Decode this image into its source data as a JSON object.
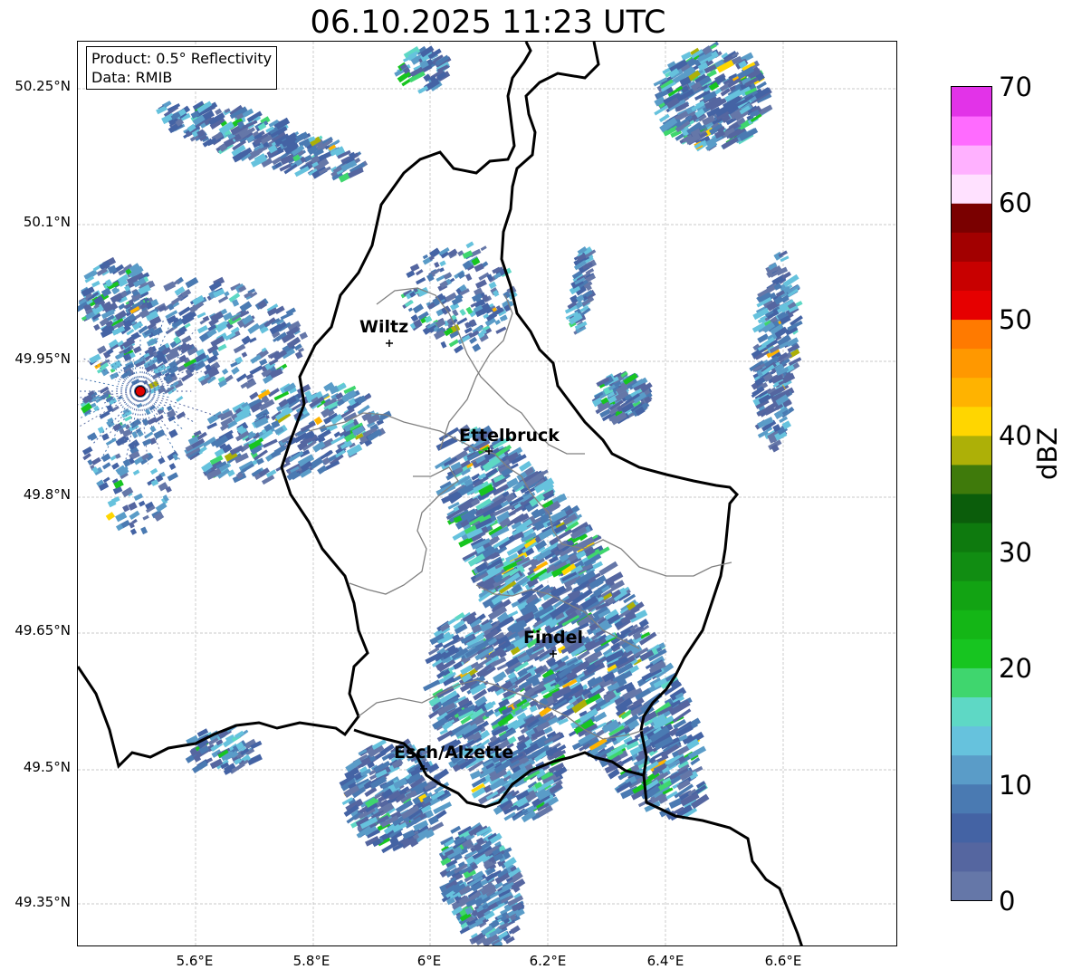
{
  "title": "06.10.2025 11:23 UTC",
  "info": {
    "product": "Product: 0.5° Reflectivity",
    "source": "Data: RMIB"
  },
  "axes": {
    "lat_labels": [
      "50.25°N",
      "50.1°N",
      "49.95°N",
      "49.8°N",
      "49.65°N",
      "49.5°N",
      "49.35°N"
    ],
    "lon_labels": [
      "5.6°E",
      "5.8°E",
      "6°E",
      "6.2°E",
      "6.4°E",
      "6.6°E"
    ],
    "grid": true
  },
  "cities": [
    {
      "name": "Wiltz"
    },
    {
      "name": "Ettelbruck"
    },
    {
      "name": "Findel"
    },
    {
      "name": "Esch/Alzette"
    }
  ],
  "radar_site": {
    "color": "#e00000"
  },
  "colorbar": {
    "label": "dBZ",
    "ticks": [
      "0",
      "10",
      "20",
      "30",
      "40",
      "50",
      "60",
      "70"
    ],
    "colors": [
      "#6577a8",
      "#5566a0",
      "#4463a4",
      "#4a7ab2",
      "#5a9cc8",
      "#66c2dd",
      "#5ed8c5",
      "#3fd66e",
      "#17c520",
      "#14b616",
      "#12a313",
      "#118d12",
      "#0e7a0e",
      "#0b5d0b",
      "#3f7a0b",
      "#adb007",
      "#ffd600",
      "#ffb300",
      "#ff9800",
      "#ff7a00",
      "#e60000",
      "#c80000",
      "#a20000",
      "#7a0000",
      "#ffe1ff",
      "#ffb1ff",
      "#ff6bff",
      "#e233e8"
    ]
  }
}
